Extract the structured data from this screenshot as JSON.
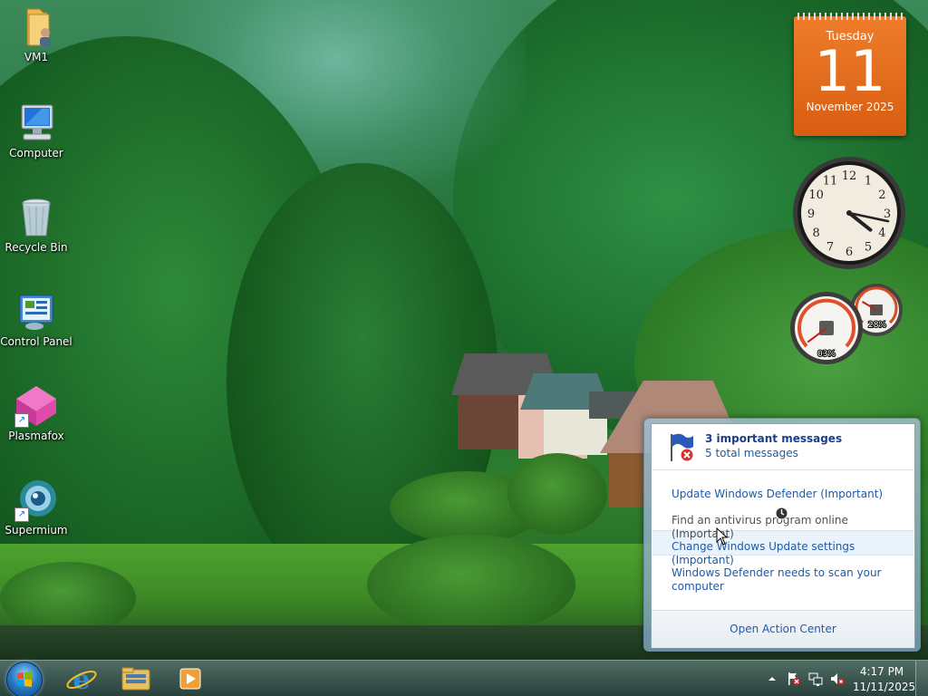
{
  "desktop": {
    "icons": [
      {
        "label": "VM1"
      },
      {
        "label": "Computer"
      },
      {
        "label": "Recycle Bin"
      },
      {
        "label": "Control Panel"
      },
      {
        "label": "Plasmafox"
      },
      {
        "label": "Supermium"
      }
    ]
  },
  "gadgets": {
    "calendar": {
      "weekday": "Tuesday",
      "day": "11",
      "month_year": "November 2025"
    },
    "clock": {
      "hour": 4,
      "minute": 17,
      "numerals": [
        "12",
        "1",
        "2",
        "3",
        "4",
        "5",
        "6",
        "7",
        "8",
        "9",
        "10",
        "11"
      ]
    },
    "meters": {
      "cpu_label": "03%",
      "memory_label": "28%",
      "cpu_percent": 3,
      "memory_percent": 28
    }
  },
  "action_center": {
    "title": "3 important messages",
    "subtitle": "5 total messages",
    "messages": [
      {
        "text": "Update Windows Defender (Important)"
      },
      {
        "text": "Find an antivirus program online (Important)"
      },
      {
        "text": "Change Windows Update settings (Important)"
      },
      {
        "text": "Windows Defender needs to scan your computer"
      }
    ],
    "footer_link": "Open Action Center"
  },
  "taskbar": {
    "pinned": [
      {
        "name": "internet-explorer"
      },
      {
        "name": "windows-explorer"
      },
      {
        "name": "media-player"
      }
    ],
    "clock": {
      "time": "4:17 PM",
      "date": "11/11/2025"
    }
  },
  "colors": {
    "calendar_orange": "#e06a1a",
    "link_blue": "#1e5aa8",
    "title_blue": "#1e3c8c"
  }
}
